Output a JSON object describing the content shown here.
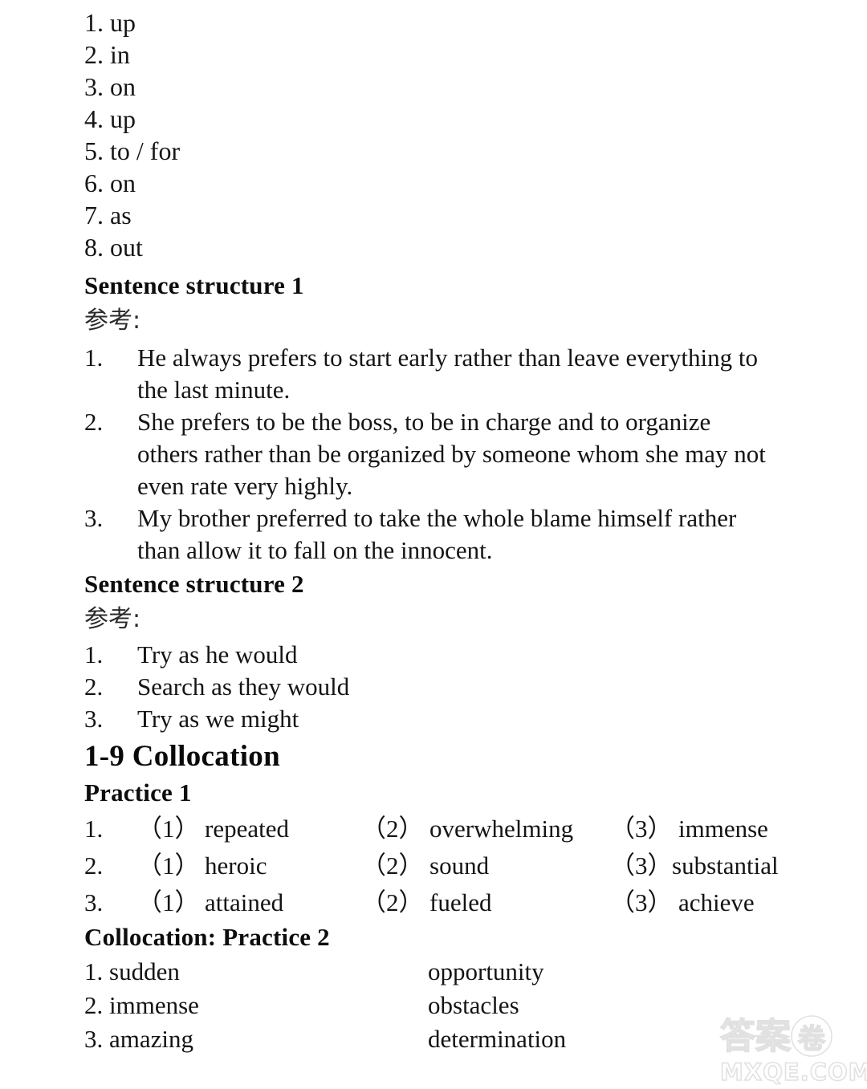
{
  "page": {
    "background_color": "#ffffff",
    "text_color": "#141414"
  },
  "preposition_answers": {
    "items": [
      "1. up",
      "2. in",
      "3. on",
      "4. up",
      "5. to / for",
      "6. on",
      "7. as",
      "8. out"
    ]
  },
  "sentence_structure_1": {
    "heading": "Sentence structure 1",
    "note": "参考:",
    "items": [
      {
        "number": "1.",
        "text": "He always prefers to start early rather than leave everything to the last minute."
      },
      {
        "number": "2.",
        "text": "She prefers to be the boss, to be in charge and to organize others rather than be organized by someone whom she may not even rate very highly."
      },
      {
        "number": "3.",
        "text": "My brother preferred to take the whole blame himself rather than allow it to fall on the innocent."
      }
    ]
  },
  "sentence_structure_2": {
    "heading": "Sentence structure 2",
    "note": "参考:",
    "items": [
      {
        "number": "1.",
        "text": "Try as he would"
      },
      {
        "number": "2.",
        "text": "Search as they would"
      },
      {
        "number": "3.",
        "text": "Try as we might"
      }
    ]
  },
  "collocation": {
    "section_heading": "1-9 Collocation",
    "practice1": {
      "heading": "Practice 1",
      "rows": [
        {
          "number": "1.",
          "a_label": "（1）",
          "a_value": "repeated",
          "b_label": "（2）",
          "b_value": "overwhelming",
          "c_label": "（3）",
          "c_value": "immense"
        },
        {
          "number": "2.",
          "a_label": "（1）",
          "a_value": "heroic",
          "b_label": "（2）",
          "b_value": "sound",
          "c_label": "（3）",
          "c_value": "substantial"
        },
        {
          "number": "3.",
          "a_label": "（1）",
          "a_value": "attained",
          "b_label": "（2）",
          "b_value": "fueled",
          "c_label": "（3）",
          "c_value": "achieve"
        }
      ]
    },
    "practice2": {
      "heading": "Collocation: Practice 2",
      "rows": [
        {
          "left": "1. sudden",
          "right": "opportunity"
        },
        {
          "left": "2. immense",
          "right": "obstacles"
        },
        {
          "left": "3. amazing",
          "right": "determination"
        }
      ]
    }
  },
  "watermark": {
    "cjk_text": "答案",
    "cjk_circled": "卷",
    "latin_text": "MXQE.COM",
    "color": "#dcdcdc"
  }
}
